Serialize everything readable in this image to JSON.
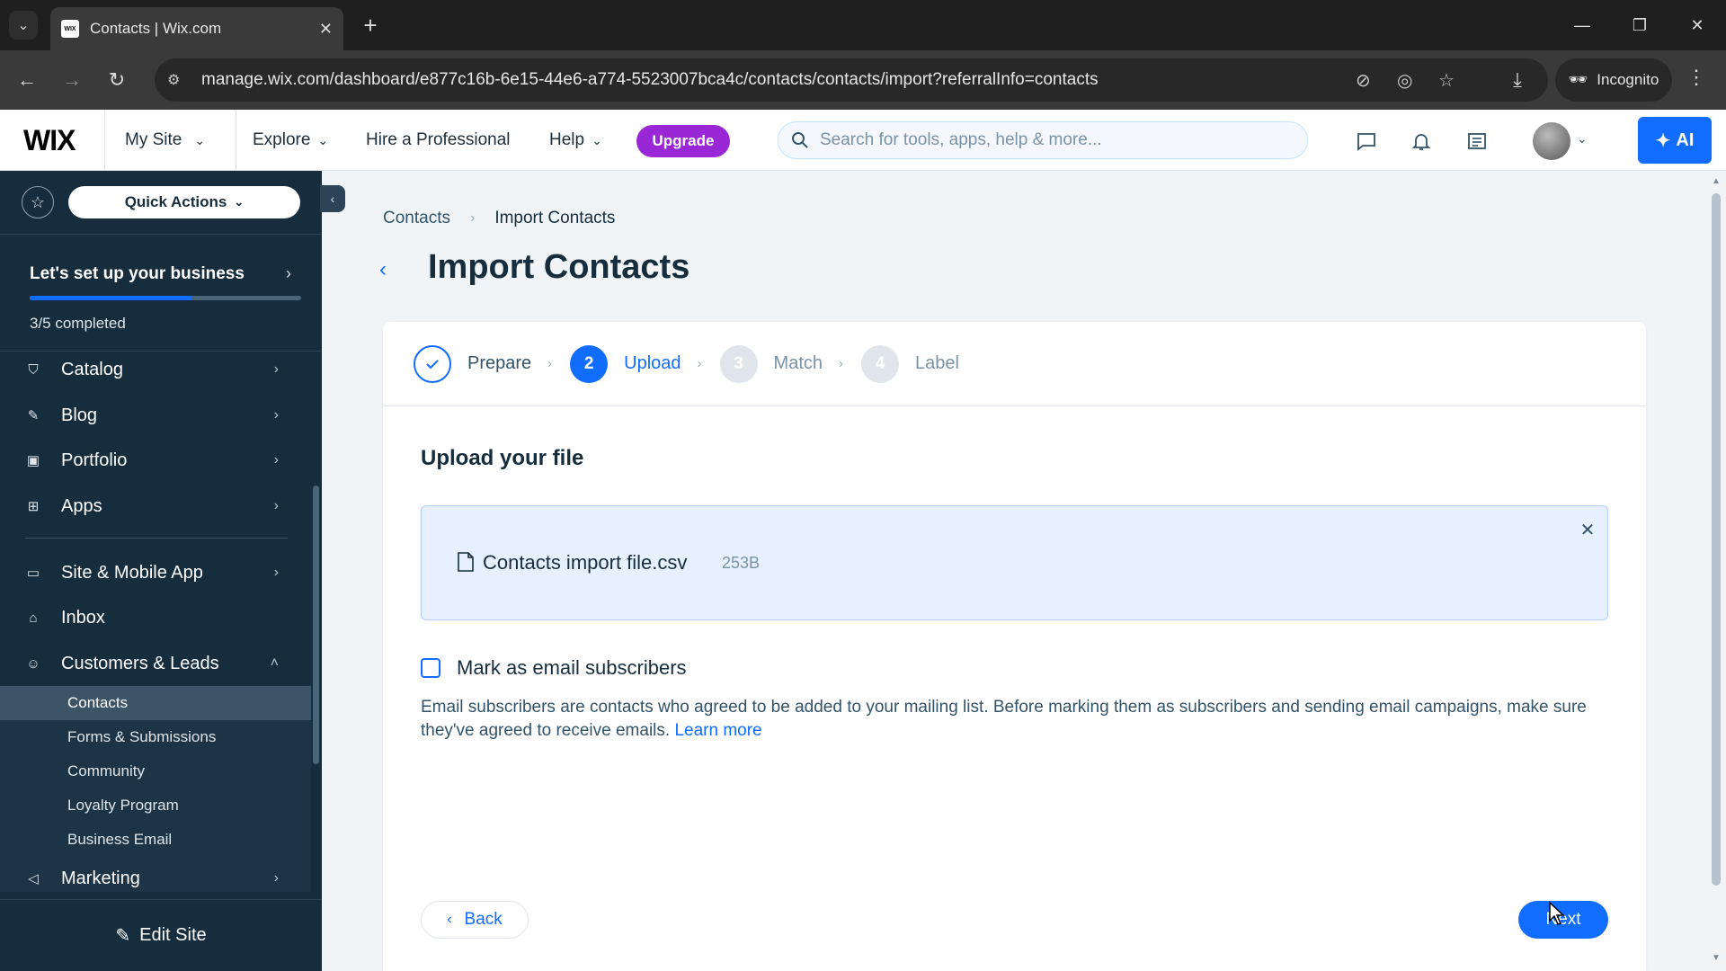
{
  "browser": {
    "tab_title": "Contacts | Wix.com",
    "favicon_text": "WIX",
    "url": "manage.wix.com/dashboard/e877c16b-6e15-44e6-a774-5523007bca4c/contacts/contacts/import?referralInfo=contacts",
    "incognito_label": "Incognito"
  },
  "topbar": {
    "logo": "WIX",
    "my_site": "My Site",
    "explore": "Explore",
    "hire": "Hire a Professional",
    "help": "Help",
    "upgrade": "Upgrade",
    "search_placeholder": "Search for tools, apps, help & more...",
    "ai_label": "AI"
  },
  "sidebar": {
    "quick_actions": "Quick Actions",
    "setup_title": "Let's set up your business",
    "setup_count": "3/5 completed",
    "setup_progress": 0.6,
    "items": [
      {
        "label": "Catalog",
        "icon": "catalog-icon"
      },
      {
        "label": "Blog",
        "icon": "blog-icon"
      },
      {
        "label": "Portfolio",
        "icon": "portfolio-icon"
      },
      {
        "label": "Apps",
        "icon": "apps-icon"
      },
      {
        "label": "Site & Mobile App",
        "icon": "site-mobile-icon"
      },
      {
        "label": "Inbox",
        "icon": "inbox-icon"
      },
      {
        "label": "Customers & Leads",
        "icon": "customers-icon"
      }
    ],
    "subitems": [
      "Contacts",
      "Forms & Submissions",
      "Community",
      "Loyalty Program",
      "Business Email"
    ],
    "marketing": "Marketing",
    "edit_site": "Edit Site"
  },
  "main": {
    "breadcrumb": [
      "Contacts",
      "Import Contacts"
    ],
    "title": "Import Contacts",
    "steps": [
      {
        "num": "1",
        "label": "Prepare",
        "state": "done"
      },
      {
        "num": "2",
        "label": "Upload",
        "state": "active"
      },
      {
        "num": "3",
        "label": "Match",
        "state": "todo"
      },
      {
        "num": "4",
        "label": "Label",
        "state": "todo"
      }
    ],
    "section_title": "Upload your file",
    "file_name": "Contacts import file.csv",
    "file_size": "253B",
    "checkbox_label": "Mark as email subscribers",
    "description": "Email subscribers are contacts who agreed to be added to your mailing list. Before marking them as subscribers and sending email campaigns, make sure they've agreed to receive emails.",
    "learn_more": "Learn more",
    "back": "Back",
    "next": "Next"
  },
  "colors": {
    "primary": "#116dff",
    "sidebar_bg": "#162d3d",
    "upgrade": "#9a27d5"
  }
}
